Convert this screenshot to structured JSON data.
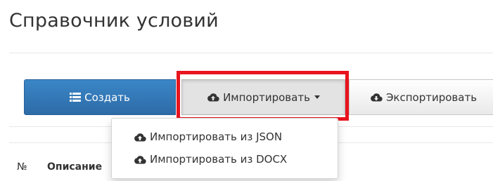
{
  "page": {
    "title": "Справочник условий"
  },
  "toolbar": {
    "create_label": "Создать",
    "create_icon": "list-icon",
    "import_label": "Импортировать",
    "import_icon": "cloud-upload-icon",
    "export_label": "Экспортировать",
    "export_icon": "cloud-download-icon"
  },
  "import_menu": {
    "items": [
      {
        "label": "Импортировать из JSON",
        "icon": "cloud-upload-icon"
      },
      {
        "label": "Импортировать из DOCX",
        "icon": "cloud-upload-icon"
      }
    ]
  },
  "table": {
    "columns": [
      "№",
      "Описание"
    ]
  },
  "colors": {
    "primary": "#337ab7",
    "highlight": "#e8141e"
  }
}
